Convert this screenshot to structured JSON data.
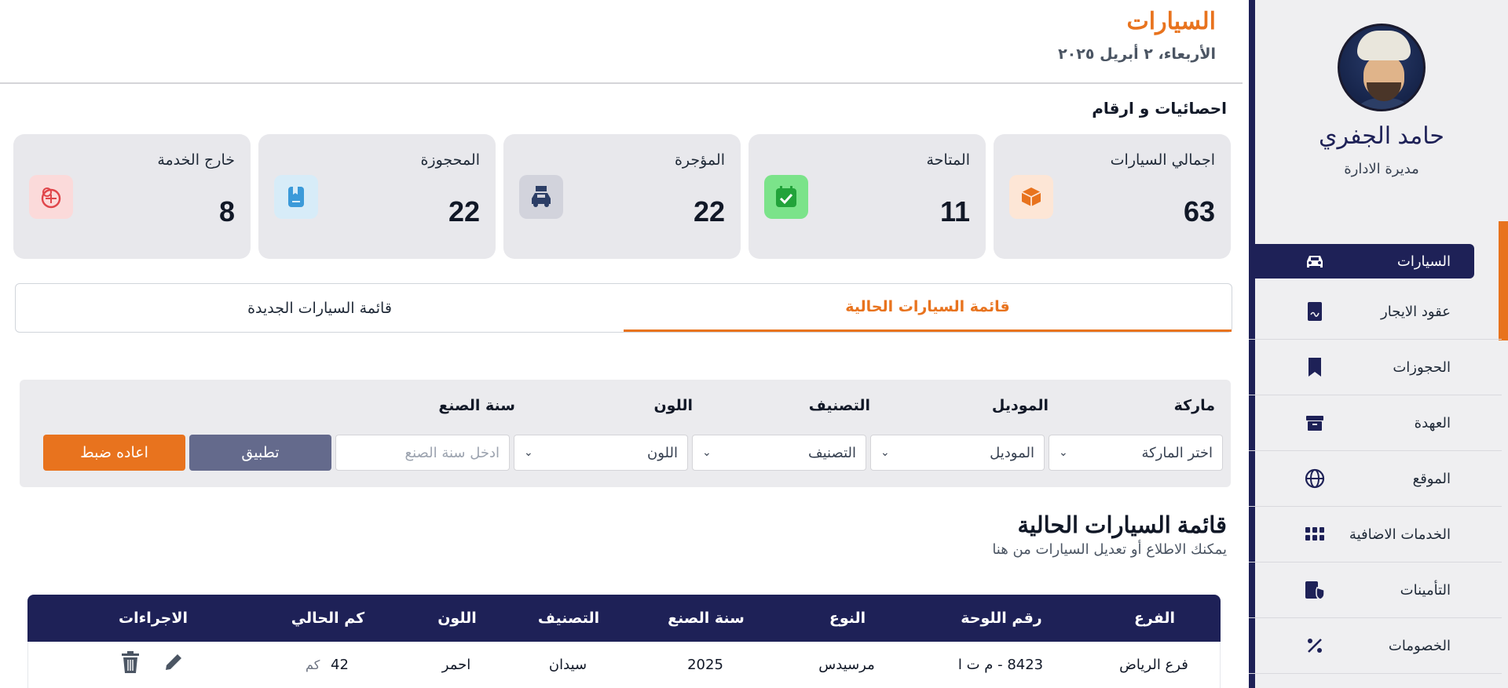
{
  "header": {
    "title": "السيارات",
    "date": "الأربعاء، ٢ أبريل ٢٠٢٥"
  },
  "profile": {
    "name": "حامد الجفري",
    "role": "مديرة الادارة"
  },
  "sidebar": {
    "items": [
      {
        "label": "السيارات",
        "icon": "car-icon",
        "active": true
      },
      {
        "label": "عقود الايجار",
        "icon": "contract-icon"
      },
      {
        "label": "الحجوزات",
        "icon": "bookmark-icon"
      },
      {
        "label": "العهدة",
        "icon": "box-icon"
      },
      {
        "label": "الموقع",
        "icon": "globe-icon"
      },
      {
        "label": "الخدمات الاضافية",
        "icon": "grid-icon"
      },
      {
        "label": "التأمينات",
        "icon": "insurance-icon"
      },
      {
        "label": "الخصومات",
        "icon": "percent-icon"
      }
    ]
  },
  "stats": {
    "title": "احصائيات و ارقام",
    "cards": [
      {
        "label": "اجمالي السيارات",
        "value": "63",
        "icon": "cube-icon",
        "color": "#e8731e",
        "bg": "#fde6d6"
      },
      {
        "label": "المتاحة",
        "value": "11",
        "icon": "calendar-check-icon",
        "color": "#22a33a",
        "bg": "#7be38a"
      },
      {
        "label": "المؤجرة",
        "value": "22",
        "icon": "rent-car-icon",
        "color": "#2c3e66",
        "bg": "#d2d3dc"
      },
      {
        "label": "المحجوزة",
        "value": "22",
        "icon": "booking-icon",
        "color": "#3b9ad9",
        "bg": "#d7ecf8"
      },
      {
        "label": "خارج الخدمة",
        "value": "8",
        "icon": "out-of-service-icon",
        "color": "#e0454a",
        "bg": "#fbdada"
      }
    ]
  },
  "tabs": [
    {
      "label": "قائمة السيارات الحالية",
      "active": true
    },
    {
      "label": "قائمة السيارات الجديدة",
      "active": false
    }
  ],
  "filters": {
    "brand": {
      "label": "ماركة",
      "value": "اختر الماركة"
    },
    "model": {
      "label": "الموديل",
      "value": "الموديل"
    },
    "category": {
      "label": "التصنيف",
      "value": "التصنيف"
    },
    "color": {
      "label": "اللون",
      "value": "اللون"
    },
    "year": {
      "label": "سنة الصنع",
      "placeholder": "ادخل سنة الصنع"
    },
    "apply_label": "تطبيق",
    "reset_label": "اعاده ضبط"
  },
  "list": {
    "title": "قائمة السيارات الحالية",
    "subtitle": "يمكنك الاطلاع أو تعديل السيارات من هنا"
  },
  "table": {
    "headers": [
      "الفرع",
      "رقم اللوحة",
      "النوع",
      "سنة الصنع",
      "التصنيف",
      "اللون",
      "كم الحالي",
      "الاجراءات"
    ],
    "rows": [
      {
        "branch": "فرع الرياض",
        "plate": "8423 - م ت ا",
        "type": "مرسيدس",
        "year": "2025",
        "category": "سيدان",
        "color": "احمر",
        "km": "42",
        "km_unit": "كم"
      }
    ]
  },
  "colors": {
    "brand": "#1e2157",
    "accent": "#e8731e"
  }
}
